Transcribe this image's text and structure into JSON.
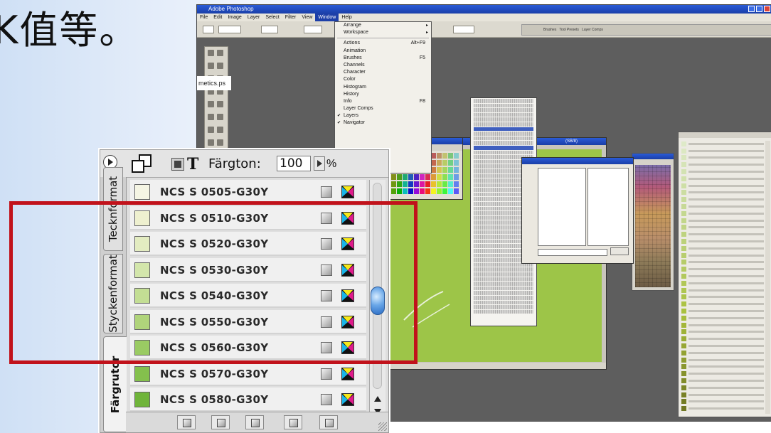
{
  "slide": {
    "heading": "K值等。"
  },
  "photoshop": {
    "title": "Adobe Photoshop",
    "menubar": [
      "File",
      "Edit",
      "Image",
      "Layer",
      "Select",
      "Filter",
      "View",
      "Window",
      "Help"
    ],
    "active_menu": "Window",
    "window_menu": {
      "items": [
        {
          "label": "Arrange",
          "shortcut": "",
          "submenu": true,
          "checked": false
        },
        {
          "label": "Workspace",
          "shortcut": "",
          "submenu": true,
          "checked": false
        },
        {
          "sep": true
        },
        {
          "label": "Actions",
          "shortcut": "Alt+F9",
          "submenu": false,
          "checked": false
        },
        {
          "label": "Animation",
          "shortcut": "",
          "submenu": false,
          "checked": false
        },
        {
          "label": "Brushes",
          "shortcut": "F5",
          "submenu": false,
          "checked": false
        },
        {
          "label": "Channels",
          "shortcut": "",
          "submenu": false,
          "checked": false
        },
        {
          "label": "Character",
          "shortcut": "",
          "submenu": false,
          "checked": false
        },
        {
          "label": "Color",
          "shortcut": "",
          "submenu": false,
          "checked": false
        },
        {
          "label": "Histogram",
          "shortcut": "",
          "submenu": false,
          "checked": false
        },
        {
          "label": "History",
          "shortcut": "",
          "submenu": false,
          "checked": false
        },
        {
          "label": "Info",
          "shortcut": "F8",
          "submenu": false,
          "checked": false
        },
        {
          "label": "Layer Comps",
          "shortcut": "",
          "submenu": false,
          "checked": false
        },
        {
          "label": "Layers",
          "shortcut": "",
          "submenu": false,
          "checked": true
        },
        {
          "label": "Navigator",
          "shortcut": "",
          "submenu": false,
          "checked": true
        }
      ]
    },
    "doc_filename_fragment": "metics.ps",
    "doc_title_fragment": "(SB/8)",
    "palette_well_tabs": [
      "Brushes",
      "Tool Presets",
      "Layer Comps"
    ]
  },
  "swatch_panel": {
    "tint_label": "Färgton:",
    "tint_value": "100",
    "percent": "%",
    "tool_t": "T",
    "tabs": [
      "Färgrutor",
      "Styckenformat",
      "Tecknformat"
    ],
    "rows": [
      {
        "name": "NCS S 0505-G30Y",
        "color": "#f5f5e4"
      },
      {
        "name": "NCS S 0510-G30Y",
        "color": "#eef0cf"
      },
      {
        "name": "NCS S 0520-G30Y",
        "color": "#e3ecc1"
      },
      {
        "name": "NCS S 0530-G30Y",
        "color": "#d3e6ab"
      },
      {
        "name": "NCS S 0540-G30Y",
        "color": "#c3de94"
      },
      {
        "name": "NCS S 0550-G30Y",
        "color": "#b0d47b"
      },
      {
        "name": "NCS S 0560-G30Y",
        "color": "#9acb63"
      },
      {
        "name": "NCS S 0570-G30Y",
        "color": "#84c04d"
      },
      {
        "name": "NCS S 0580-G30Y",
        "color": "#6fb43a"
      }
    ],
    "footer_buttons": [
      "show-all-swatches",
      "show-color-swatches",
      "show-gradient-swatches",
      "new-swatch",
      "delete-swatch"
    ]
  },
  "colors": {
    "highlight": "#c1121b",
    "doc_canvas": "#9dc548",
    "ps_blue": "#1d3fa8"
  }
}
